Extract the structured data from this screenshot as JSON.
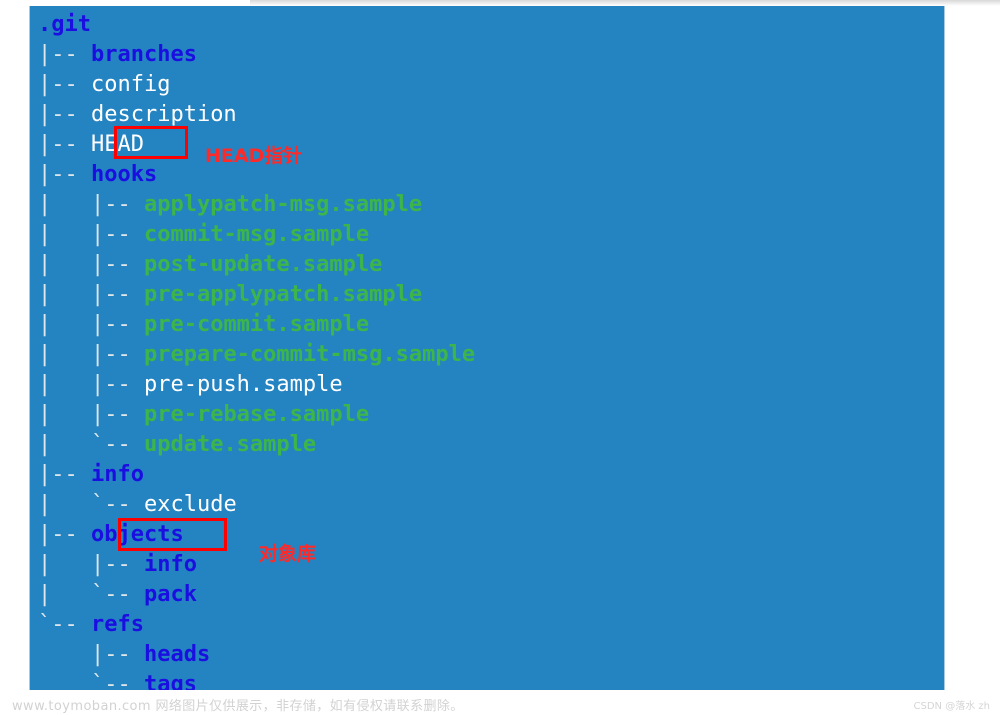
{
  "terminal": {
    "background_color": "#2484c2",
    "root_label": ".git",
    "colors": {
      "directory": "#1a0fe0",
      "executable": "#3db54a",
      "regular_file": "#ffffff",
      "connector": "#dfe6ea",
      "annotation": "#fe2a2a"
    },
    "lines": [
      {
        "connector": "",
        "name": ".git",
        "kind": "root"
      },
      {
        "connector": "|-- ",
        "name": "branches",
        "kind": "dir"
      },
      {
        "connector": "|-- ",
        "name": "config",
        "kind": "file"
      },
      {
        "connector": "|-- ",
        "name": "description",
        "kind": "file"
      },
      {
        "connector": "|-- ",
        "name": "HEAD",
        "kind": "file"
      },
      {
        "connector": "|-- ",
        "name": "hooks",
        "kind": "dir"
      },
      {
        "connector": "|   |-- ",
        "name": "applypatch-msg.sample",
        "kind": "exec"
      },
      {
        "connector": "|   |-- ",
        "name": "commit-msg.sample",
        "kind": "exec"
      },
      {
        "connector": "|   |-- ",
        "name": "post-update.sample",
        "kind": "exec"
      },
      {
        "connector": "|   |-- ",
        "name": "pre-applypatch.sample",
        "kind": "exec"
      },
      {
        "connector": "|   |-- ",
        "name": "pre-commit.sample",
        "kind": "exec"
      },
      {
        "connector": "|   |-- ",
        "name": "prepare-commit-msg.sample",
        "kind": "exec"
      },
      {
        "connector": "|   |-- ",
        "name": "pre-push.sample",
        "kind": "file"
      },
      {
        "connector": "|   |-- ",
        "name": "pre-rebase.sample",
        "kind": "exec"
      },
      {
        "connector": "|   `-- ",
        "name": "update.sample",
        "kind": "exec"
      },
      {
        "connector": "|-- ",
        "name": "info",
        "kind": "dir"
      },
      {
        "connector": "|   `-- ",
        "name": "exclude",
        "kind": "file"
      },
      {
        "connector": "|-- ",
        "name": "objects",
        "kind": "dir"
      },
      {
        "connector": "|   |-- ",
        "name": "info",
        "kind": "dir"
      },
      {
        "connector": "|   `-- ",
        "name": "pack",
        "kind": "dir"
      },
      {
        "connector": "`-- ",
        "name": "refs",
        "kind": "dir"
      },
      {
        "connector": "    |-- ",
        "name": "heads",
        "kind": "dir"
      },
      {
        "connector": "    `-- ",
        "name": "tags",
        "kind": "dir"
      }
    ]
  },
  "annotations": [
    {
      "target": "HEAD",
      "label": "HEAD指针"
    },
    {
      "target": "objects",
      "label": "对象库"
    }
  ],
  "footer": {
    "note": "www.toymoban.com 网络图片仅供展示，非存储，如有侵权请联系删除。",
    "watermark": "CSDN @落水 zh"
  }
}
